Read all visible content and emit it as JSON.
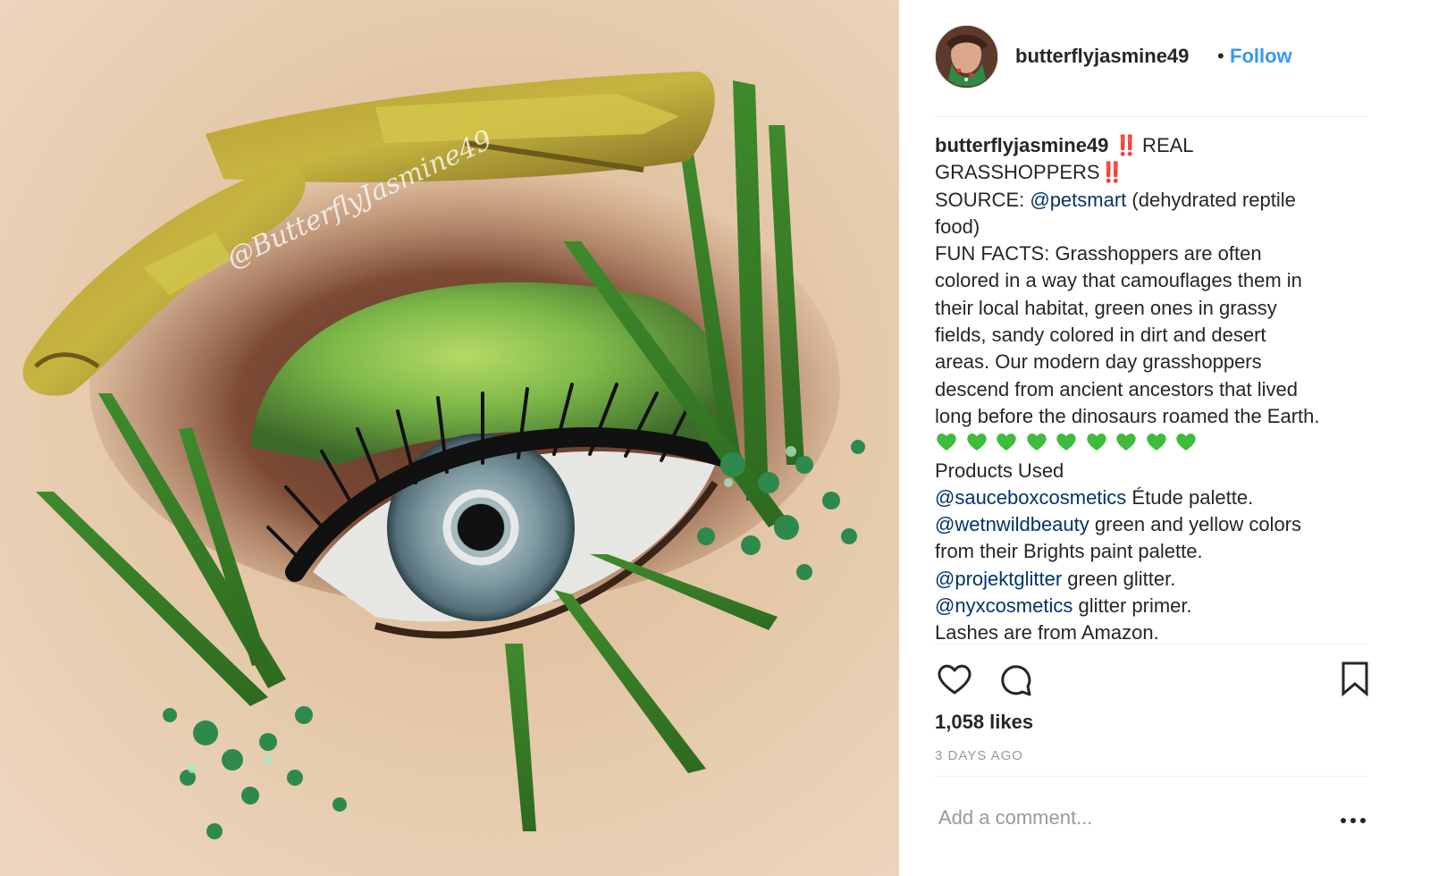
{
  "post": {
    "image_alt": "Eye makeup with green eyeshadow, grass blades, green glitter and dried grasshoppers",
    "watermark": "@ButterflyJasmine49"
  },
  "header": {
    "username": "butterflyjasmine49",
    "separator": "•",
    "follow_label": "Follow",
    "avatar_icon": "profile-avatar"
  },
  "caption": {
    "username": "butterflyjasmine49",
    "bang_icon": "‼️",
    "line1_text": " REAL",
    "line2_text": "GRASSHOPPERS",
    "line3_prefix": "SOURCE: ",
    "line3_mention": "@petsmart",
    "line3_suffix": " (dehydrated reptile",
    "line4_text": "food)",
    "fun_facts": [
      "FUN FACTS: Grasshoppers are often",
      "colored in a way that camouflages them in",
      "their local habitat, green ones in grassy",
      "fields, sandy colored in dirt and desert",
      "areas. Our modern day grasshoppers",
      "descend from ancient ancestors that lived",
      "long before the dinosaurs roamed the Earth."
    ],
    "green_hearts": [
      "💚",
      "💚",
      "💚",
      "💚",
      "💚",
      "💚",
      "💚",
      "💚",
      "💚"
    ],
    "products_heading": "Products Used",
    "products": [
      {
        "mention": "@sauceboxcosmetics",
        "text": " Étude palette."
      },
      {
        "mention": "@wetnwildbeauty",
        "text": " green and yellow colors"
      },
      {
        "mention": "",
        "text": "from their Brights paint palette."
      },
      {
        "mention": "@projektglitter",
        "text": " green glitter."
      },
      {
        "mention": "@nyxcosmetics",
        "text": " glitter primer."
      },
      {
        "mention": "",
        "text": "Lashes are from Amazon."
      }
    ]
  },
  "actions": {
    "like_icon": "heart-outline-icon",
    "comment_icon": "comment-bubble-icon",
    "save_icon": "bookmark-outline-icon"
  },
  "likes_text": "1,058 likes",
  "date_text": "3 DAYS AGO",
  "comment": {
    "placeholder": "Add a comment...",
    "value": "",
    "more_icon": "ellipsis-icon"
  },
  "colors": {
    "link": "#3897f0",
    "mention": "#003569",
    "text": "#262626",
    "muted": "#999999",
    "divider": "#efefef",
    "bang": "#e0151d",
    "heart_green": "#3fbc3c"
  }
}
